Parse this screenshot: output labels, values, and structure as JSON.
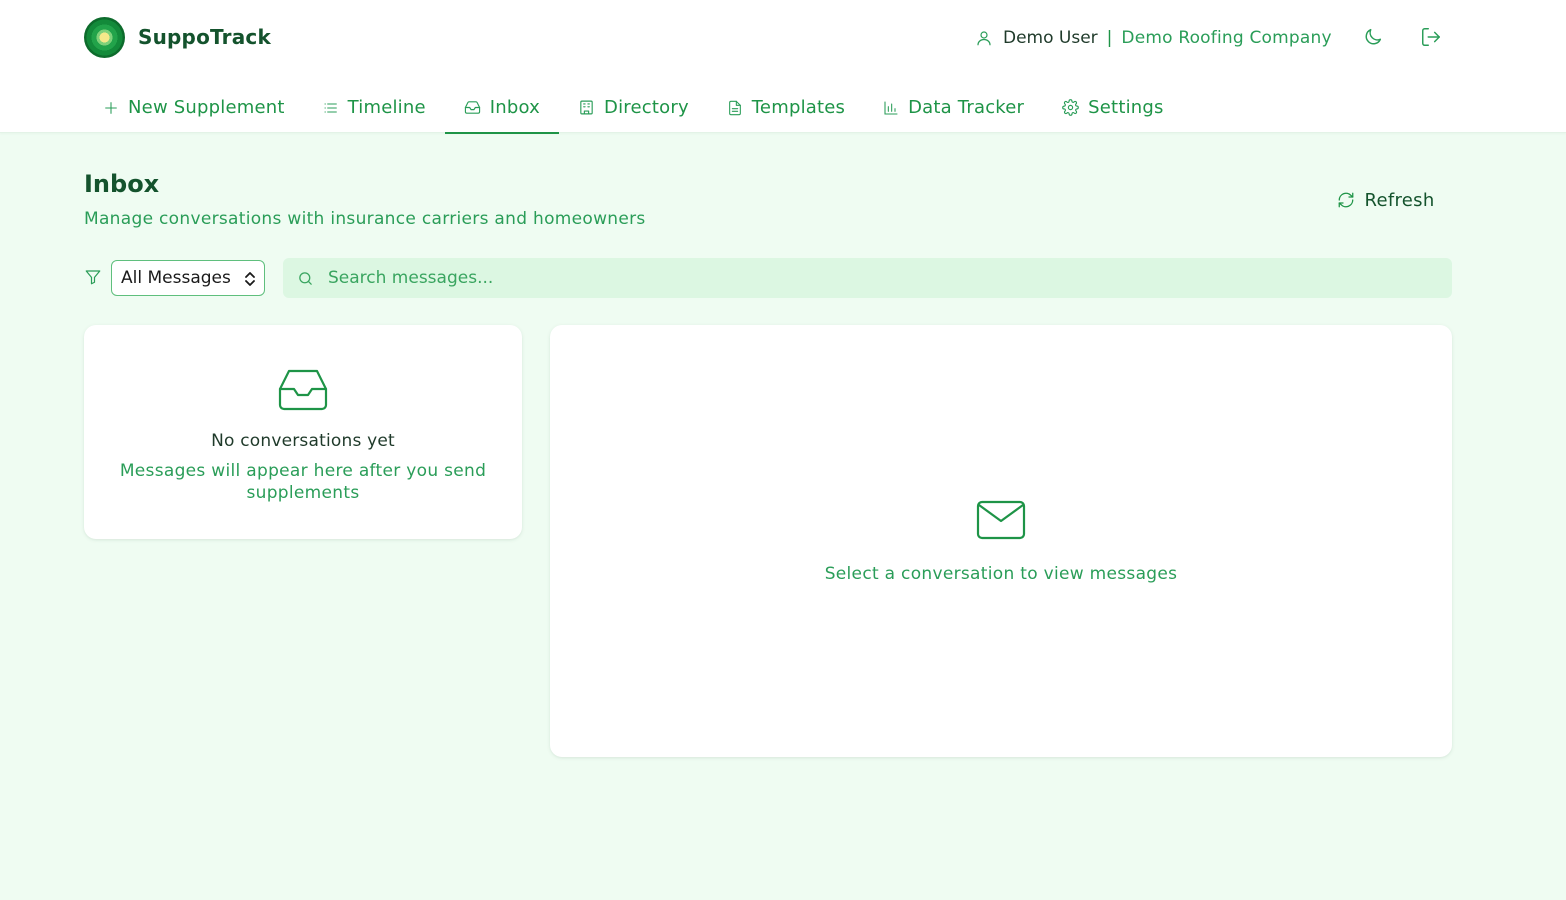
{
  "app": {
    "name": "SuppoTrack",
    "logo_icon": "concentric-circle-logo"
  },
  "user": {
    "icon": "user-icon",
    "name": "Demo User",
    "separator": "|",
    "company": "Demo Roofing Company"
  },
  "header_actions": [
    {
      "icon": "moon-icon",
      "label": "Toggle theme"
    },
    {
      "icon": "logout-icon",
      "label": "Log out"
    }
  ],
  "tabs": [
    {
      "label": "New Supplement",
      "icon": "plus-icon",
      "active": false
    },
    {
      "label": "Timeline",
      "icon": "list-icon",
      "active": false
    },
    {
      "label": "Inbox",
      "icon": "inbox-icon",
      "active": true
    },
    {
      "label": "Directory",
      "icon": "building-icon",
      "active": false
    },
    {
      "label": "Templates",
      "icon": "file-text-icon",
      "active": false
    },
    {
      "label": "Data Tracker",
      "icon": "bar-chart-icon",
      "active": false
    },
    {
      "label": "Settings",
      "icon": "gear-icon",
      "active": false
    }
  ],
  "page": {
    "title": "Inbox",
    "subtitle": "Manage conversations with insurance carriers and homeowners",
    "refresh_label": "Refresh"
  },
  "filters": {
    "filter_icon": "filter-icon",
    "selected": "All Messages",
    "search_placeholder": "Search messages..."
  },
  "conversation_list": {
    "empty_icon": "inbox-tray-icon",
    "empty_title": "No conversations yet",
    "empty_subtitle": "Messages will appear here after you send supplements"
  },
  "detail": {
    "icon": "mail-icon",
    "message": "Select a conversation to view messages"
  },
  "colors": {
    "accent": "#1e9447",
    "dark_text": "#14532d",
    "page_bg": "#effcf2",
    "search_bg": "#dcf7e2"
  }
}
